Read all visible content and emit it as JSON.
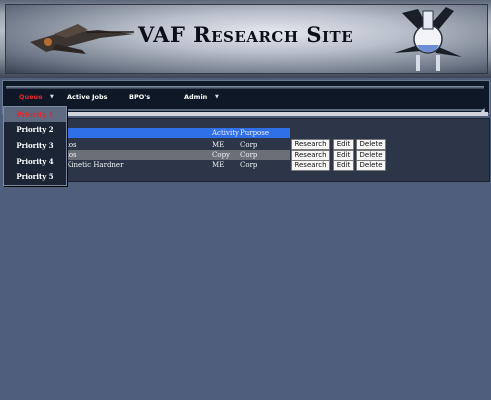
{
  "banner": {
    "title": "VAF Research Site",
    "ship_icon": "spaceship-image",
    "flask_icon": "flask-logo-image"
  },
  "nav": {
    "items": [
      {
        "label": "Queue",
        "has_dropdown": true,
        "active": true
      },
      {
        "label": "Active Jobs",
        "has_dropdown": false,
        "active": false
      },
      {
        "label": "BPO's",
        "has_dropdown": false,
        "active": false
      },
      {
        "label": "Admin",
        "has_dropdown": true,
        "active": false
      }
    ],
    "arrow_glyph": "▼"
  },
  "queue_dropdown": {
    "items": [
      "Priority 1",
      "Priority 2",
      "Priority 3",
      "Priority 4",
      "Priority 5"
    ]
  },
  "table": {
    "headers": {
      "activity": "Activity",
      "purpose": "Purpose"
    },
    "rows": [
      {
        "item": "tos",
        "activity": "ME",
        "purpose": "Corp"
      },
      {
        "item": "tos",
        "activity": "Copy",
        "purpose": "Corp"
      },
      {
        "item": "Kinetic Hardner",
        "activity": "ME",
        "purpose": "Corp"
      }
    ],
    "actions": {
      "research": "Research",
      "edit": "Edit",
      "delete": "Delete"
    }
  },
  "colors": {
    "page_bg": "#4f5f7b",
    "header_row": "#2f6fe8",
    "active_nav": "#e8262b",
    "selected_row": "#6b6f78"
  }
}
